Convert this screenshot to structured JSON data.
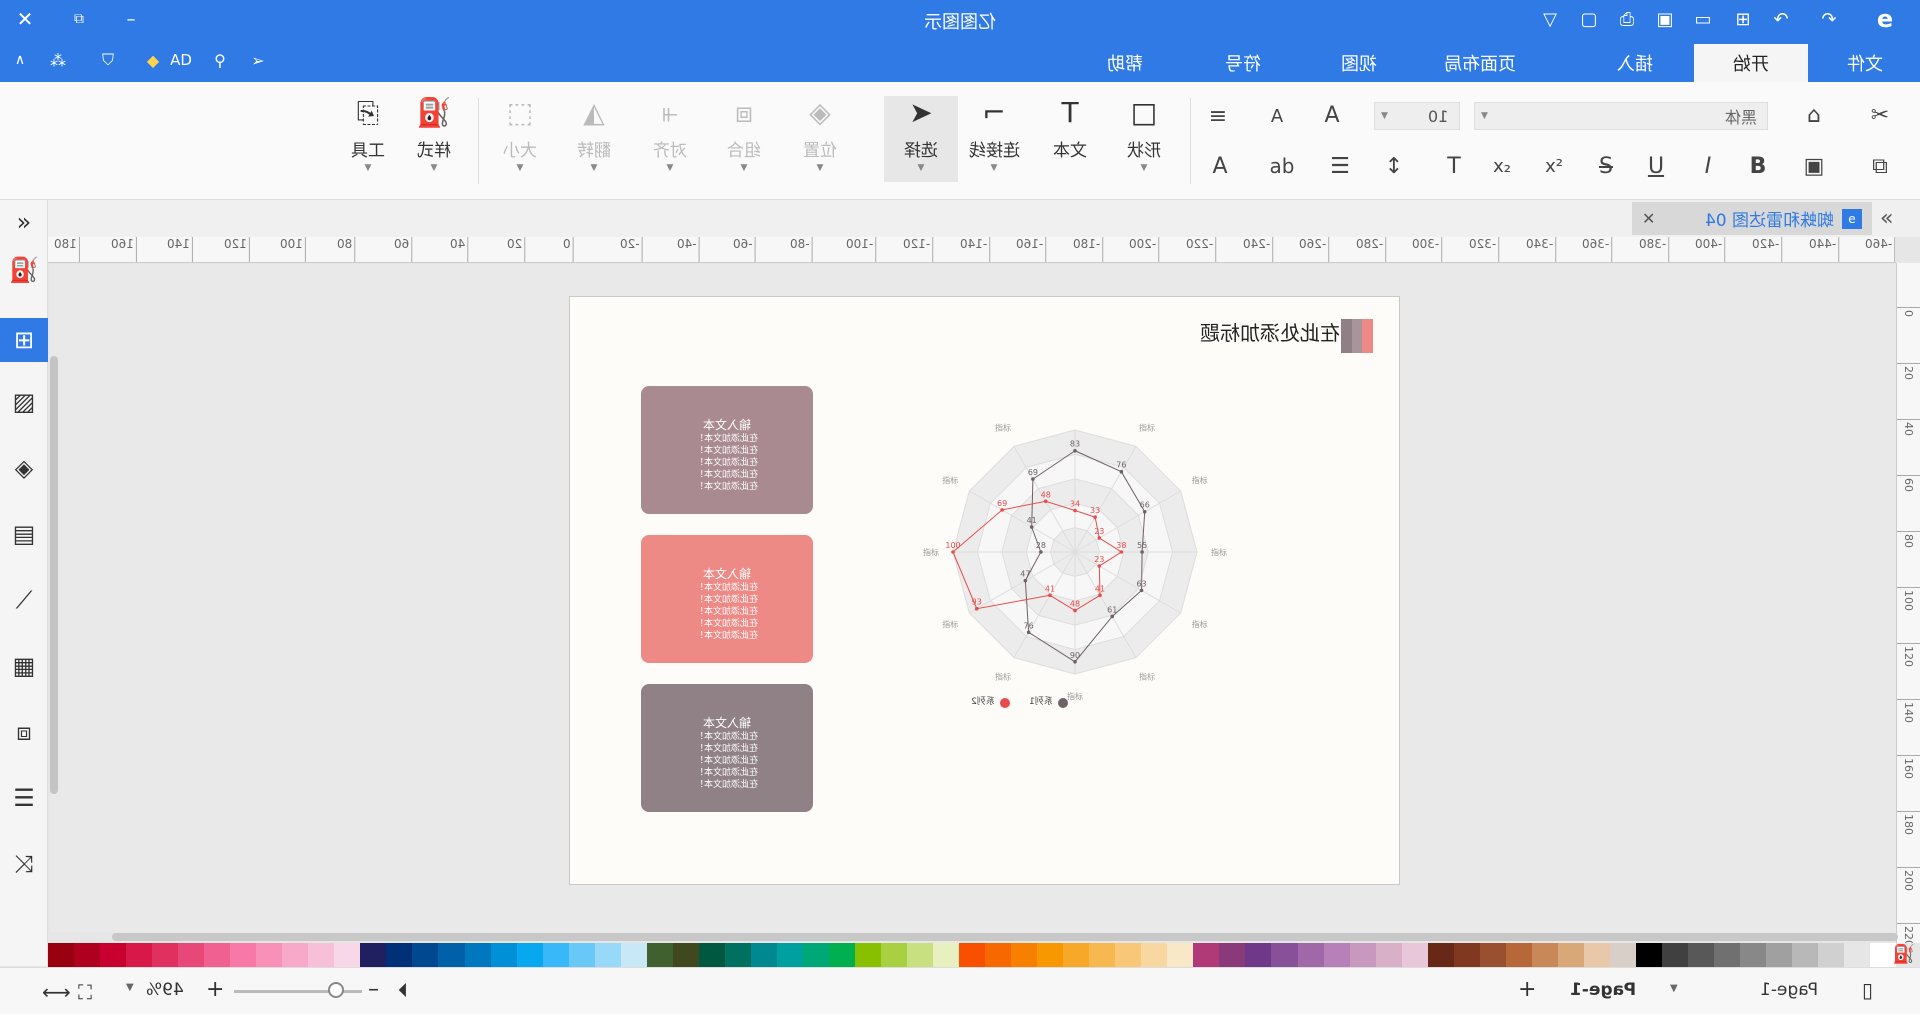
{
  "app": {
    "title": "亿图图示"
  },
  "menu_tabs": [
    {
      "label": "文件"
    },
    {
      "label": "开始"
    },
    {
      "label": "插入"
    },
    {
      "label": "页面布局"
    },
    {
      "label": "视图"
    },
    {
      "label": "符号"
    },
    {
      "label": "帮助"
    }
  ],
  "ribbon": {
    "font_name_placeholder": "黑体",
    "font_size": "10",
    "shape_label": "形状",
    "text_label": "文本",
    "connector_label": "连接线",
    "select_label": "选择",
    "position_label": "位置",
    "group_label": "组合",
    "align_label": "对齐",
    "flip_label": "翻转",
    "size_label": "大小",
    "style_label": "样式",
    "tools_label": "工具"
  },
  "doc_tab": {
    "label": "蜘蛛和雷达图 04"
  },
  "hruler_labels": [
    "180",
    "160",
    "140",
    "120",
    "100",
    "80",
    "60",
    "40",
    "20",
    "0",
    "-20",
    "-40",
    "-60",
    "-80",
    "-100",
    "-120",
    "-140",
    "-160",
    "-180",
    "-200",
    "-220",
    "-240",
    "-260",
    "-280",
    "-300",
    "-320",
    "-340",
    "-360",
    "-380",
    "-400",
    "-420",
    "-440",
    "-460"
  ],
  "vruler_labels": [
    "0",
    "20",
    "40",
    "60",
    "80",
    "100",
    "120",
    "140",
    "160",
    "180",
    "200",
    "220"
  ],
  "page": {
    "title": "在此处添加标题",
    "cards": [
      {
        "title": "输入文本",
        "lines": [
          "在此添加文本！",
          "在此添加文本！",
          "在此添加文本！",
          "在此添加文本！",
          "在此添加文本！"
        ]
      },
      {
        "title": "输入文本",
        "lines": [
          "在此添加文本！",
          "在此添加文本！",
          "在此添加文本！",
          "在此添加文本！",
          "在此添加文本！"
        ]
      },
      {
        "title": "输入文本",
        "lines": [
          "在此添加文本！",
          "在此添加文本！",
          "在此添加文本！",
          "在此添加文本！",
          "在此添加文本！"
        ]
      }
    ],
    "legend": [
      {
        "label": "系列1",
        "color": "#6e6266"
      },
      {
        "label": "系列2",
        "color": "#e84b4b"
      }
    ]
  },
  "chart_data": {
    "type": "radar",
    "axes": [
      "指标",
      "指标",
      "指标",
      "指标",
      "指标",
      "指标",
      "指标",
      "指标",
      "指标",
      "指标",
      "指标",
      "指标"
    ],
    "rmax": 100,
    "series": [
      {
        "name": "系列1",
        "color": "#6e6266",
        "values": [
          83,
          69,
          41,
          28,
          47,
          76,
          90,
          61,
          63,
          55,
          66,
          76
        ]
      },
      {
        "name": "系列2",
        "color": "#e84b4b",
        "values": [
          34,
          48,
          69,
          100,
          93,
          41,
          48,
          41,
          23,
          38,
          23,
          33
        ]
      }
    ]
  },
  "status": {
    "page_tab": "Page-1",
    "page_select": "Page-1",
    "zoom": "49%"
  },
  "colors": {
    "titlebar": "#2f7ae5",
    "card1": "#a88a90",
    "card2": "#ee8a86",
    "card3": "#8f8185"
  }
}
